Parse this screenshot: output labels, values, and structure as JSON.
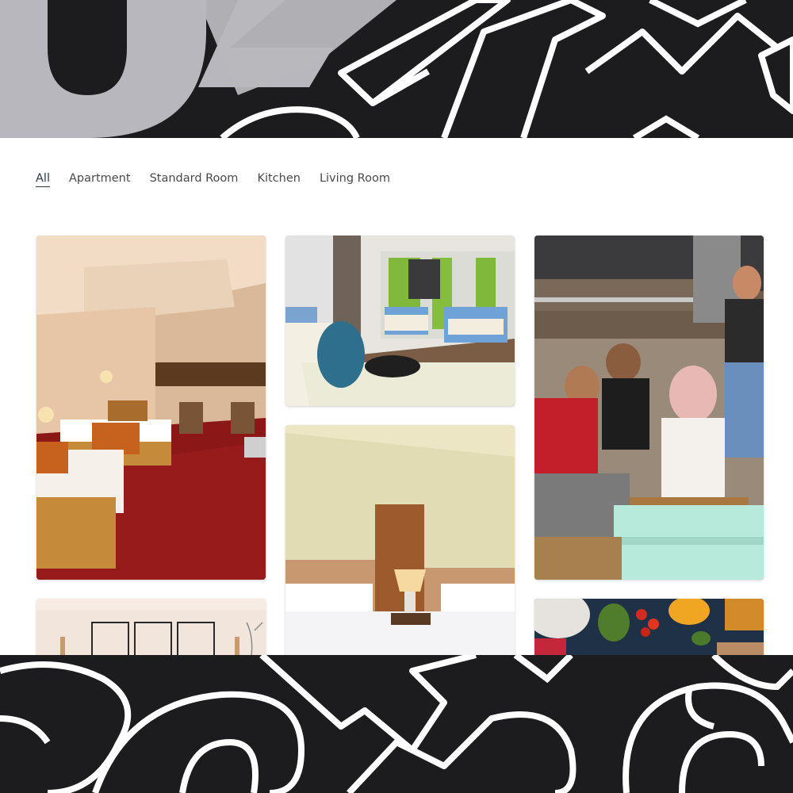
{
  "filter_tabs": [
    {
      "label": "All",
      "active": true
    },
    {
      "label": "Apartment",
      "active": false
    },
    {
      "label": "Standard Room",
      "active": false
    },
    {
      "label": "Kitchen",
      "active": false
    },
    {
      "label": "Living Room",
      "active": false
    }
  ],
  "gallery": [
    {
      "subject": "hotel twin room with red carpet"
    },
    {
      "subject": "dormitory room with green curtains and backpack"
    },
    {
      "subject": "friends playing chess on bunk bed"
    },
    {
      "subject": "hotel twin beds with lamp"
    },
    {
      "subject": "living room wall with picture frames"
    },
    {
      "subject": "kitchen ingredients on table"
    }
  ],
  "colors": {
    "background": "#1c1b1d",
    "panel": "#ffffff",
    "active_tab": "#2b3a4f",
    "tab_text": "#4a4a4a"
  }
}
